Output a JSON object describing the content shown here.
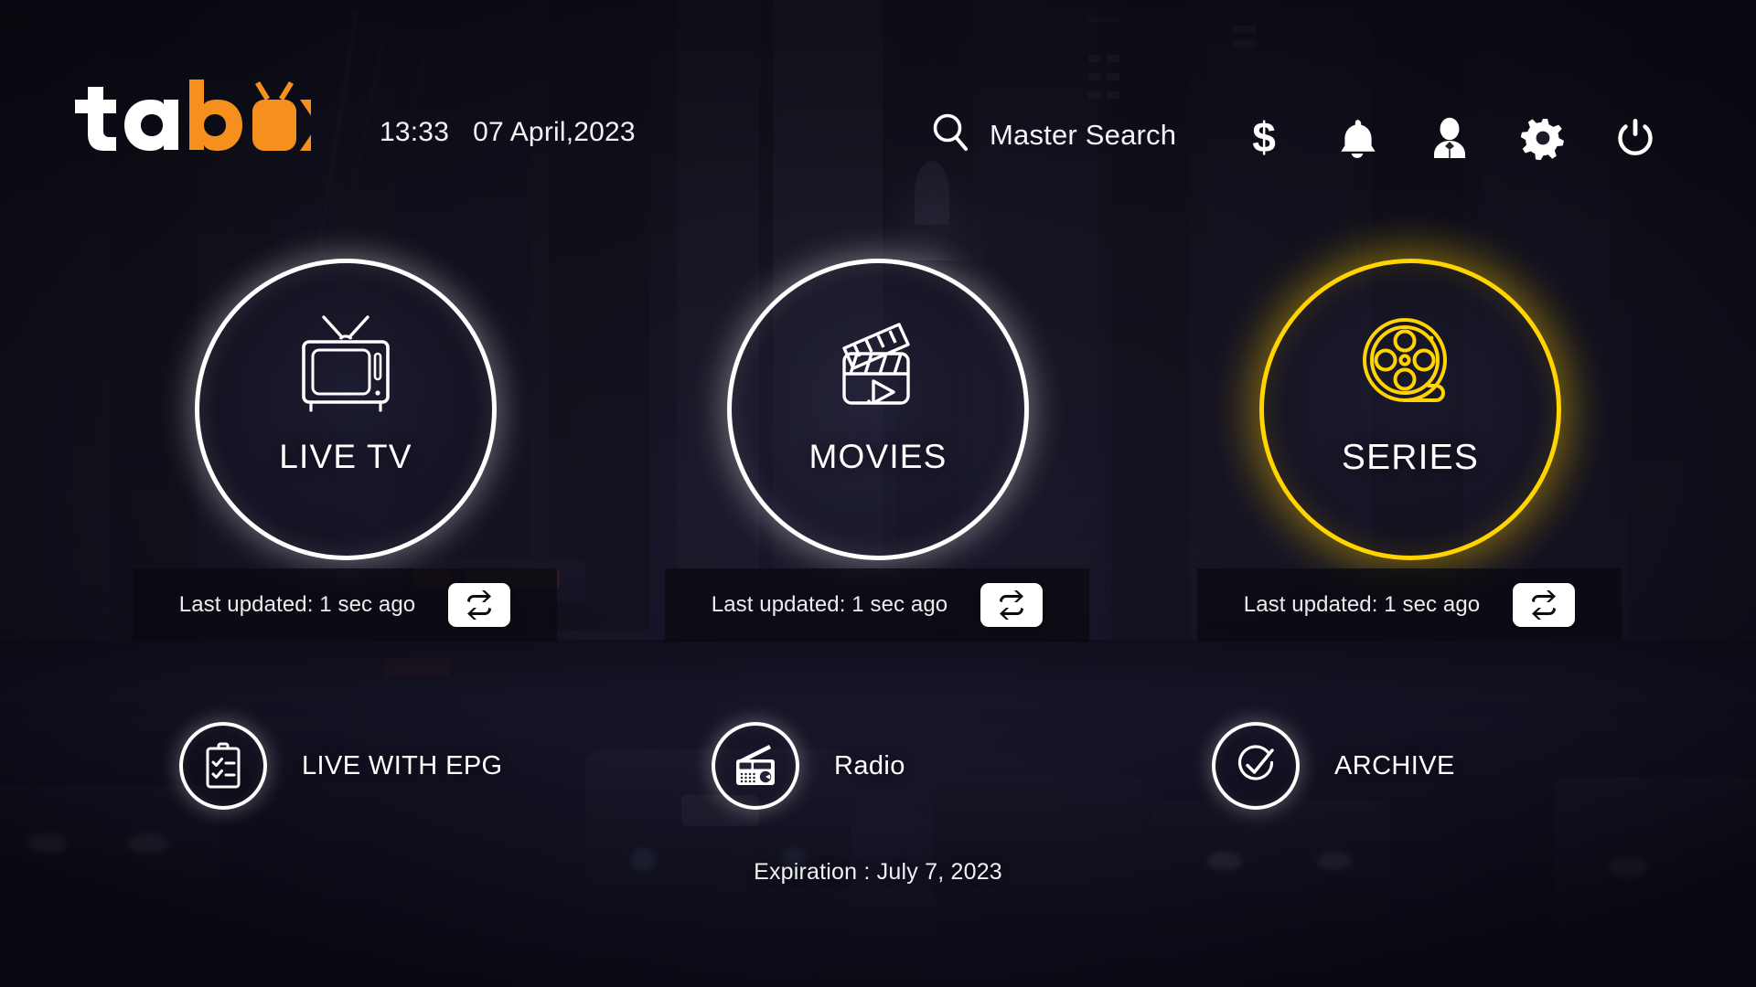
{
  "app": {
    "name": "tabox",
    "logo_parts": {
      "white": "ta",
      "orange_b": "b",
      "tv_o": "o",
      "orange_x": "x"
    },
    "brand_orange": "#F5901F",
    "accent_yellow": "#FFD400"
  },
  "header": {
    "time": "13:33",
    "date": "07 April,2023",
    "search": {
      "label": "Master Search",
      "icon": "search-icon"
    },
    "icons": [
      {
        "name": "dollar-icon",
        "label": "$"
      },
      {
        "name": "bell-icon",
        "label": "Notifications"
      },
      {
        "name": "user-icon",
        "label": "Account"
      },
      {
        "name": "gear-icon",
        "label": "Settings"
      },
      {
        "name": "power-icon",
        "label": "Power"
      }
    ]
  },
  "tiles": [
    {
      "id": "live-tv",
      "label": "LIVE TV",
      "icon": "television-icon",
      "selected": false,
      "status": "Last updated: 1 sec ago",
      "refresh_icon": "refresh-repeat-icon"
    },
    {
      "id": "movies",
      "label": "MOVIES",
      "icon": "clapperboard-play-icon",
      "selected": false,
      "status": "Last updated: 1 sec ago",
      "refresh_icon": "refresh-repeat-icon"
    },
    {
      "id": "series",
      "label": "SERIES",
      "icon": "film-reel-icon",
      "selected": true,
      "status": "Last updated: 1 sec ago",
      "refresh_icon": "refresh-repeat-icon"
    }
  ],
  "secondary": [
    {
      "id": "live-with-epg",
      "label": "LIVE WITH EPG",
      "icon": "clipboard-checklist-icon"
    },
    {
      "id": "radio",
      "label": "Radio",
      "icon": "radio-receiver-icon"
    },
    {
      "id": "archive",
      "label": "ARCHIVE",
      "icon": "check-circle-icon"
    }
  ],
  "footer": {
    "expiration": "Expiration : July 7, 2023"
  }
}
